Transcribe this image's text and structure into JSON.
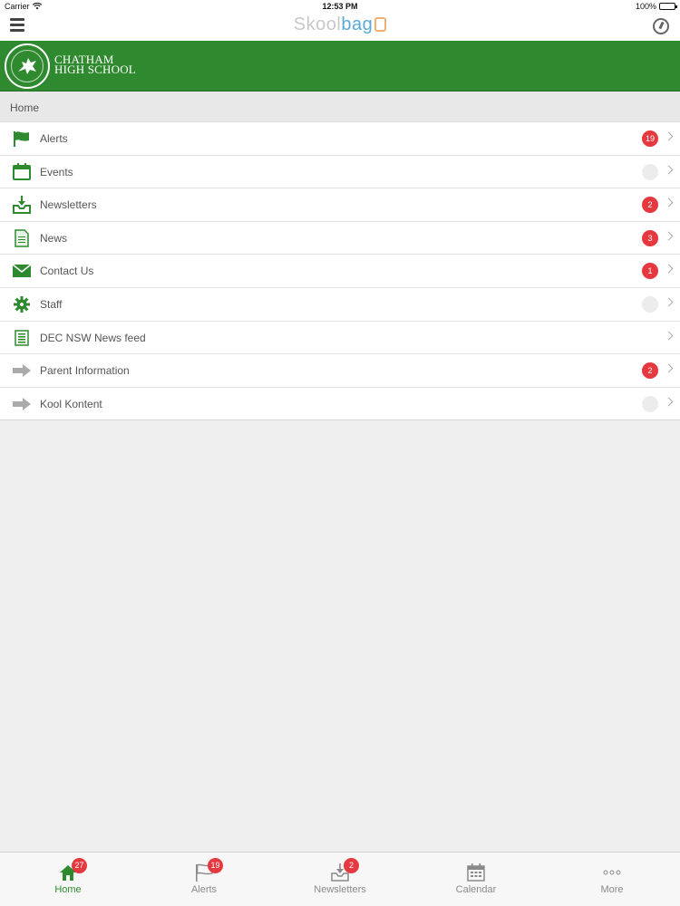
{
  "status_bar": {
    "carrier": "Carrier",
    "time": "12:53 PM",
    "battery": "100%"
  },
  "top_nav": {
    "brand_part1": "Skool",
    "brand_part2": "bag"
  },
  "school": {
    "name_line1": "CHATHAM",
    "name_line2": "HIGH SCHOOL"
  },
  "breadcrumb": "Home",
  "menu": [
    {
      "label": "Alerts",
      "badge": "19",
      "icon": "flag-icon"
    },
    {
      "label": "Events",
      "badge": "",
      "icon": "calendar-icon"
    },
    {
      "label": "Newsletters",
      "badge": "2",
      "icon": "inbox-download-icon"
    },
    {
      "label": "News",
      "badge": "3",
      "icon": "document-icon"
    },
    {
      "label": "Contact Us",
      "badge": "1",
      "icon": "envelope-icon"
    },
    {
      "label": "Staff",
      "badge": "",
      "icon": "gear-icon"
    },
    {
      "label": "DEC NSW News feed",
      "badge": null,
      "icon": "newspaper-icon"
    },
    {
      "label": "Parent Information",
      "badge": "2",
      "icon": "arrow-right-icon"
    },
    {
      "label": "Kool Kontent",
      "badge": "",
      "icon": "arrow-right-icon"
    }
  ],
  "tabs": [
    {
      "label": "Home",
      "badge": "27",
      "icon": "home-icon",
      "active": true
    },
    {
      "label": "Alerts",
      "badge": "19",
      "icon": "flag-icon",
      "active": false
    },
    {
      "label": "Newsletters",
      "badge": "2",
      "icon": "inbox-download-icon",
      "active": false
    },
    {
      "label": "Calendar",
      "badge": null,
      "icon": "calendar-icon",
      "active": false
    },
    {
      "label": "More",
      "badge": null,
      "icon": "ellipsis-icon",
      "active": false
    }
  ],
  "colors": {
    "brand_green": "#2f8a2f",
    "badge_red": "#e5383f",
    "accent_blue": "#5aa9d6"
  }
}
